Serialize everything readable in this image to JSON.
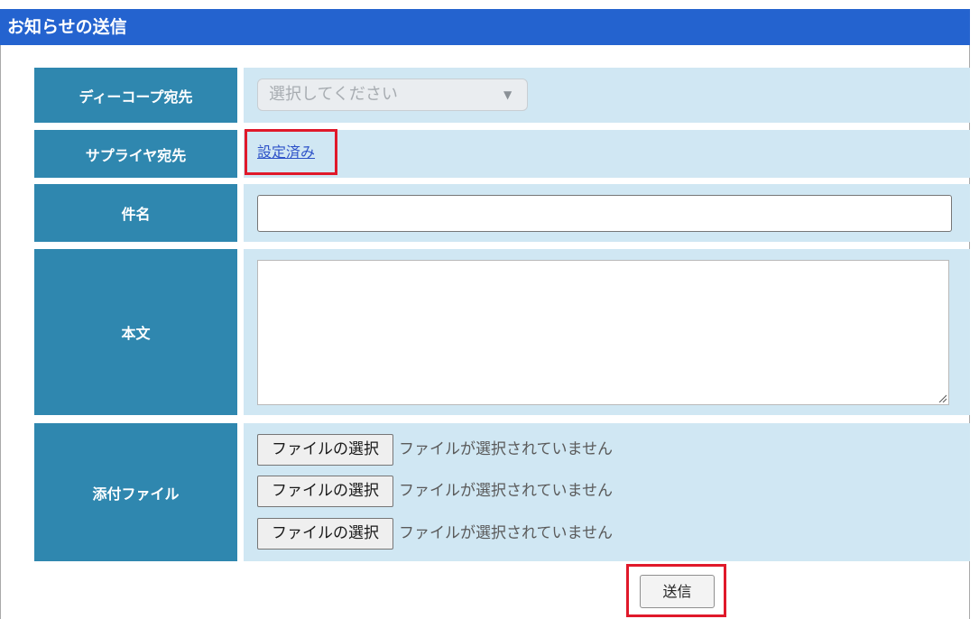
{
  "page_title": "お知らせの送信",
  "colors": {
    "title_bar": "#2463cf",
    "label_cell": "#2f87af",
    "value_cell": "#d0e7f3",
    "link": "#2d52c8",
    "highlight": "#e0192a"
  },
  "form": {
    "dcoop_recipient": {
      "label": "ディーコープ宛先",
      "select_value": "選択してください",
      "caret_icon": "triangle-down-icon"
    },
    "supplier_recipient": {
      "label": "サプライヤ宛先",
      "link_text": "設定済み"
    },
    "subject": {
      "label": "件名",
      "value": ""
    },
    "body": {
      "label": "本文",
      "value": ""
    },
    "attachments": {
      "label": "添付ファイル",
      "files": [
        {
          "button_label": "ファイルの選択",
          "status": "ファイルが選択されていません"
        },
        {
          "button_label": "ファイルの選択",
          "status": "ファイルが選択されていません"
        },
        {
          "button_label": "ファイルの選択",
          "status": "ファイルが選択されていません"
        }
      ]
    },
    "submit_label": "送信"
  }
}
